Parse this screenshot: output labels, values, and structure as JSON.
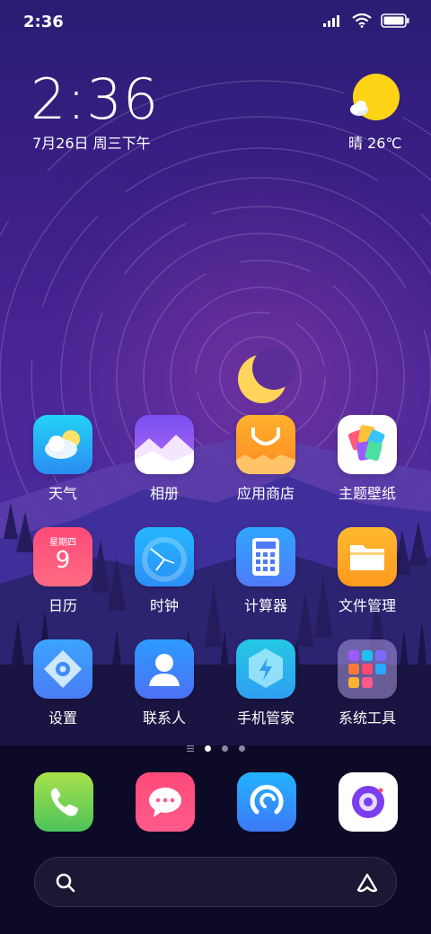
{
  "status_bar": {
    "time": "2:36"
  },
  "clock_widget": {
    "time": "2:36",
    "date": "7月26日 周三下午"
  },
  "weather_widget": {
    "condition_temp": "晴 26℃",
    "icon": "sun-cloud-icon"
  },
  "apps": [
    {
      "label": "天气",
      "icon": "weather-icon"
    },
    {
      "label": "相册",
      "icon": "gallery-icon"
    },
    {
      "label": "应用商店",
      "icon": "app-store-icon"
    },
    {
      "label": "主题壁纸",
      "icon": "theme-icon"
    },
    {
      "label": "日历",
      "icon": "calendar-icon",
      "weekday": "星期四",
      "day": "9"
    },
    {
      "label": "时钟",
      "icon": "clock-icon"
    },
    {
      "label": "计算器",
      "icon": "calculator-icon"
    },
    {
      "label": "文件管理",
      "icon": "folder-icon"
    },
    {
      "label": "设置",
      "icon": "settings-icon"
    },
    {
      "label": "联系人",
      "icon": "contacts-icon"
    },
    {
      "label": "手机管家",
      "icon": "phone-manager-icon"
    },
    {
      "label": "系统工具",
      "icon": "system-tools-folder-icon"
    }
  ],
  "page_indicator": {
    "pages": 3,
    "current": 1
  },
  "dock": [
    {
      "icon": "phone-icon"
    },
    {
      "icon": "messages-icon"
    },
    {
      "icon": "browser-icon"
    },
    {
      "icon": "camera-icon"
    }
  ],
  "search_bar": {
    "placeholder": ""
  }
}
